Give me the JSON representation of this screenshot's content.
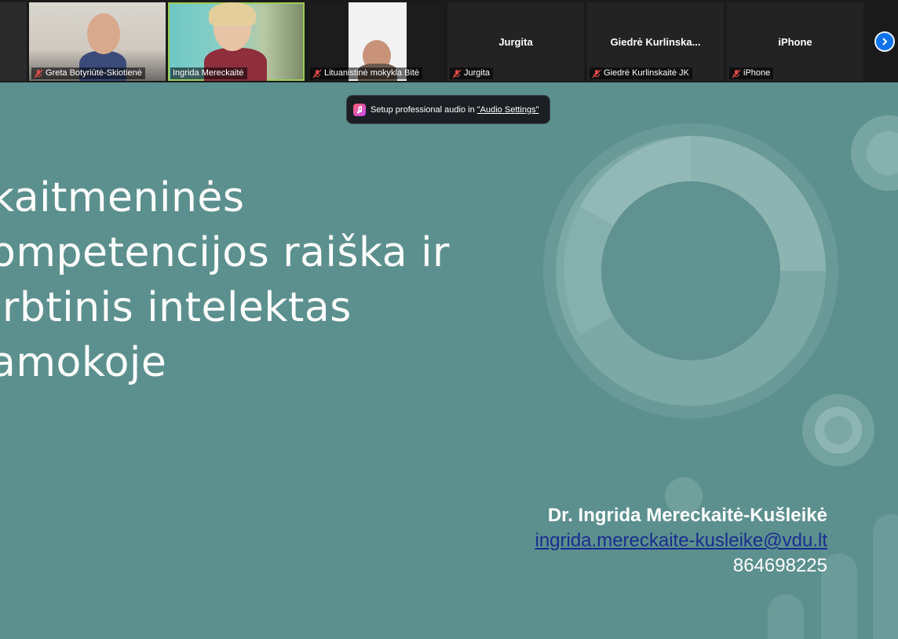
{
  "participants": [
    {
      "name": "Greta Botyriūtė-Skiotienė",
      "muted": true
    },
    {
      "name": "Ingrida Mereckaitė",
      "muted": false,
      "active": true
    },
    {
      "name": "Lituanistinė mokykla Bitė",
      "muted": true
    },
    {
      "name": "Jurgita",
      "center_label": "Jurgita",
      "muted": true
    },
    {
      "name": "Giedrė Kurlinskaitė JK",
      "center_label": "Giedrė  Kurlinska...",
      "muted": true
    },
    {
      "name": "iPhone",
      "center_label": "iPhone",
      "muted": true
    }
  ],
  "toast": {
    "text": "Setup professional audio in ",
    "link": "\"Audio Settings\"",
    "icon": "music-note-icon"
  },
  "slide": {
    "title_lines": [
      "kaitmeninės",
      "ompetencijos raiška ir",
      "irbtinis intelektas",
      "amokoje"
    ],
    "author_name": "Dr. Ingrida Mereckaitė-Kušleikė",
    "author_email": "ingrida.mereckaite-kusleike@vdu.lt",
    "author_phone": "864698225"
  },
  "colors": {
    "slide_bg": "#5c908e",
    "strip_bg": "#1a1a1a",
    "active_border": "#9ccb54",
    "next_button": "#0e72ed",
    "email_link": "#1a2d8f"
  }
}
